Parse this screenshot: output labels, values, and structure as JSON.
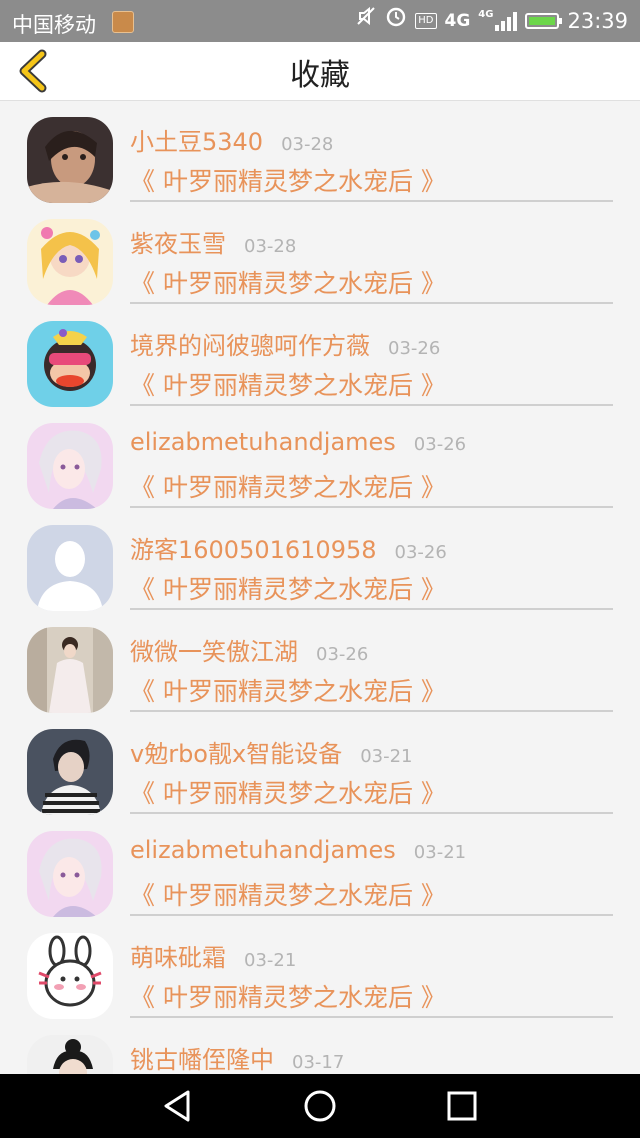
{
  "status_bar": {
    "carrier": "中国移动",
    "hd": "HD",
    "network": "4G",
    "network_small": "4G",
    "time": "23:39",
    "icons": [
      "gallery-icon",
      "mute-icon",
      "alarm-icon",
      "hd-icon",
      "signal-icon",
      "battery-charging-icon"
    ]
  },
  "header": {
    "title": "收藏",
    "back_icon": "chevron-left-icon",
    "accent_color": "#f5c518"
  },
  "favorites": [
    {
      "name": "小土豆5340",
      "date": "03-28",
      "title": "《 叶罗丽精灵梦之水宠后 》",
      "avatar": "girl-photo"
    },
    {
      "name": "紫夜玉雪",
      "date": "03-28",
      "title": "《 叶罗丽精灵梦之水宠后 》",
      "avatar": "anime-girl"
    },
    {
      "name": "境界的闷彼骢呵作方薇",
      "date": "03-26",
      "title": "《 叶罗丽精灵梦之水宠后 》",
      "avatar": "monkey-cartoon"
    },
    {
      "name": "elizabmetuhandjames",
      "date": "03-26",
      "title": "《 叶罗丽精灵梦之水宠后 》",
      "avatar": "illustrated-girl"
    },
    {
      "name": "游客1600501610958",
      "date": "03-26",
      "title": "《 叶罗丽精灵梦之水宠后 》",
      "avatar": "default-user"
    },
    {
      "name": "微微一笑傲江湖",
      "date": "03-26",
      "title": "《 叶罗丽精灵梦之水宠后 》",
      "avatar": "woman-photo"
    },
    {
      "name": "v勉rbo靓x智能设备",
      "date": "03-21",
      "title": "《 叶罗丽精灵梦之水宠后 》",
      "avatar": "man-photo"
    },
    {
      "name": "elizabmetuhandjames",
      "date": "03-21",
      "title": "《 叶罗丽精灵梦之水宠后 》",
      "avatar": "illustrated-girl"
    },
    {
      "name": "萌味砒霜",
      "date": "03-21",
      "title": "《 叶罗丽精灵梦之水宠后 》",
      "avatar": "bunny-cartoon"
    },
    {
      "name": "铫古幡侄隆中",
      "date": "03-17",
      "title": "",
      "avatar": "dark-hair-photo"
    }
  ],
  "colors": {
    "name_color": "#e8935a",
    "date_color": "#b4b4b4",
    "divider_color": "#cfcfcf"
  },
  "nav_bar": {
    "icons": [
      "back-triangle-icon",
      "home-circle-icon",
      "recents-square-icon"
    ]
  }
}
